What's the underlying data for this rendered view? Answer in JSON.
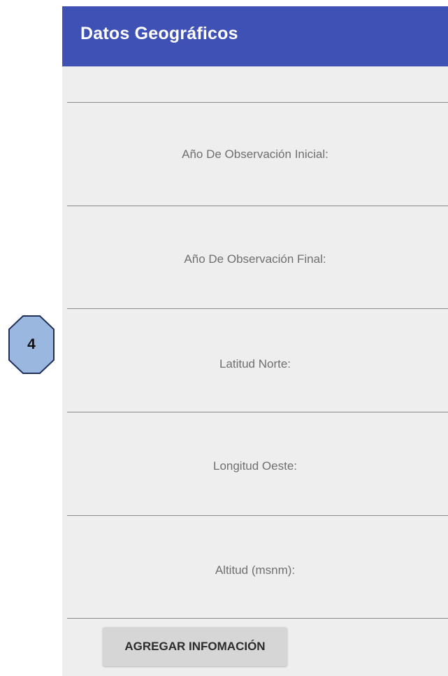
{
  "app_bar": {
    "title": "Datos Geográficos",
    "color": "#3f51b5"
  },
  "form": {
    "fields": [
      {
        "label": "Año De Observación Inicial:"
      },
      {
        "label": "Año De Observación Final:"
      },
      {
        "label": "Latitud Norte:"
      },
      {
        "label": "Longitud Oeste:"
      },
      {
        "label": "Altitud (msnm):"
      }
    ],
    "submit_label": "AGREGAR INFOMACIÓN"
  },
  "annotation": {
    "marker": "4",
    "color": "#9ab7e0"
  }
}
